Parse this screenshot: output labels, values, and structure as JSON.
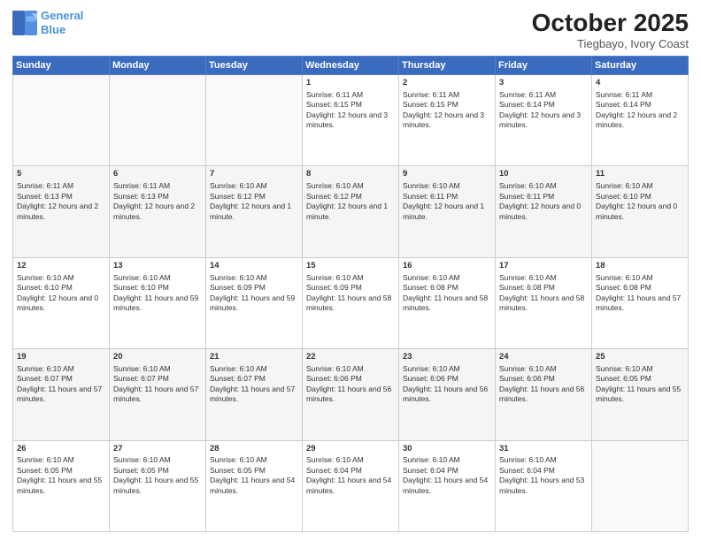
{
  "header": {
    "logo_line1": "General",
    "logo_line2": "Blue",
    "title": "October 2025",
    "subtitle": "Tiegbayo, Ivory Coast"
  },
  "weekdays": [
    "Sunday",
    "Monday",
    "Tuesday",
    "Wednesday",
    "Thursday",
    "Friday",
    "Saturday"
  ],
  "weeks": [
    [
      {
        "day": "",
        "content": ""
      },
      {
        "day": "",
        "content": ""
      },
      {
        "day": "",
        "content": ""
      },
      {
        "day": "1",
        "content": "Sunrise: 6:11 AM\nSunset: 6:15 PM\nDaylight: 12 hours and 3 minutes."
      },
      {
        "day": "2",
        "content": "Sunrise: 6:11 AM\nSunset: 6:15 PM\nDaylight: 12 hours and 3 minutes."
      },
      {
        "day": "3",
        "content": "Sunrise: 6:11 AM\nSunset: 6:14 PM\nDaylight: 12 hours and 3 minutes."
      },
      {
        "day": "4",
        "content": "Sunrise: 6:11 AM\nSunset: 6:14 PM\nDaylight: 12 hours and 2 minutes."
      }
    ],
    [
      {
        "day": "5",
        "content": "Sunrise: 6:11 AM\nSunset: 6:13 PM\nDaylight: 12 hours and 2 minutes."
      },
      {
        "day": "6",
        "content": "Sunrise: 6:11 AM\nSunset: 6:13 PM\nDaylight: 12 hours and 2 minutes."
      },
      {
        "day": "7",
        "content": "Sunrise: 6:10 AM\nSunset: 6:12 PM\nDaylight: 12 hours and 1 minute."
      },
      {
        "day": "8",
        "content": "Sunrise: 6:10 AM\nSunset: 6:12 PM\nDaylight: 12 hours and 1 minute."
      },
      {
        "day": "9",
        "content": "Sunrise: 6:10 AM\nSunset: 6:11 PM\nDaylight: 12 hours and 1 minute."
      },
      {
        "day": "10",
        "content": "Sunrise: 6:10 AM\nSunset: 6:11 PM\nDaylight: 12 hours and 0 minutes."
      },
      {
        "day": "11",
        "content": "Sunrise: 6:10 AM\nSunset: 6:10 PM\nDaylight: 12 hours and 0 minutes."
      }
    ],
    [
      {
        "day": "12",
        "content": "Sunrise: 6:10 AM\nSunset: 6:10 PM\nDaylight: 12 hours and 0 minutes."
      },
      {
        "day": "13",
        "content": "Sunrise: 6:10 AM\nSunset: 6:10 PM\nDaylight: 11 hours and 59 minutes."
      },
      {
        "day": "14",
        "content": "Sunrise: 6:10 AM\nSunset: 6:09 PM\nDaylight: 11 hours and 59 minutes."
      },
      {
        "day": "15",
        "content": "Sunrise: 6:10 AM\nSunset: 6:09 PM\nDaylight: 11 hours and 58 minutes."
      },
      {
        "day": "16",
        "content": "Sunrise: 6:10 AM\nSunset: 6:08 PM\nDaylight: 11 hours and 58 minutes."
      },
      {
        "day": "17",
        "content": "Sunrise: 6:10 AM\nSunset: 6:08 PM\nDaylight: 11 hours and 58 minutes."
      },
      {
        "day": "18",
        "content": "Sunrise: 6:10 AM\nSunset: 6:08 PM\nDaylight: 11 hours and 57 minutes."
      }
    ],
    [
      {
        "day": "19",
        "content": "Sunrise: 6:10 AM\nSunset: 6:07 PM\nDaylight: 11 hours and 57 minutes."
      },
      {
        "day": "20",
        "content": "Sunrise: 6:10 AM\nSunset: 6:07 PM\nDaylight: 11 hours and 57 minutes."
      },
      {
        "day": "21",
        "content": "Sunrise: 6:10 AM\nSunset: 6:07 PM\nDaylight: 11 hours and 57 minutes."
      },
      {
        "day": "22",
        "content": "Sunrise: 6:10 AM\nSunset: 6:06 PM\nDaylight: 11 hours and 56 minutes."
      },
      {
        "day": "23",
        "content": "Sunrise: 6:10 AM\nSunset: 6:06 PM\nDaylight: 11 hours and 56 minutes."
      },
      {
        "day": "24",
        "content": "Sunrise: 6:10 AM\nSunset: 6:06 PM\nDaylight: 11 hours and 56 minutes."
      },
      {
        "day": "25",
        "content": "Sunrise: 6:10 AM\nSunset: 6:05 PM\nDaylight: 11 hours and 55 minutes."
      }
    ],
    [
      {
        "day": "26",
        "content": "Sunrise: 6:10 AM\nSunset: 6:05 PM\nDaylight: 11 hours and 55 minutes."
      },
      {
        "day": "27",
        "content": "Sunrise: 6:10 AM\nSunset: 6:05 PM\nDaylight: 11 hours and 55 minutes."
      },
      {
        "day": "28",
        "content": "Sunrise: 6:10 AM\nSunset: 6:05 PM\nDaylight: 11 hours and 54 minutes."
      },
      {
        "day": "29",
        "content": "Sunrise: 6:10 AM\nSunset: 6:04 PM\nDaylight: 11 hours and 54 minutes."
      },
      {
        "day": "30",
        "content": "Sunrise: 6:10 AM\nSunset: 6:04 PM\nDaylight: 11 hours and 54 minutes."
      },
      {
        "day": "31",
        "content": "Sunrise: 6:10 AM\nSunset: 6:04 PM\nDaylight: 11 hours and 53 minutes."
      },
      {
        "day": "",
        "content": ""
      }
    ]
  ]
}
